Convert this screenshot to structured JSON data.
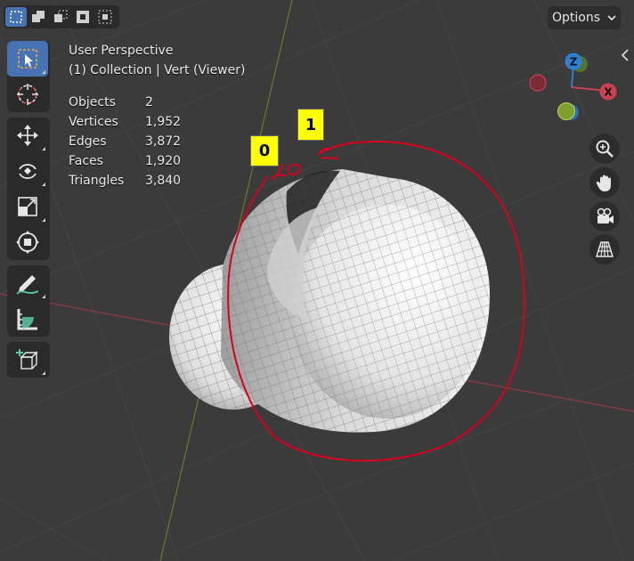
{
  "header": {
    "options_label": "Options",
    "select_modes": [
      "select-box",
      "select-extend",
      "select-subtract",
      "select-invert",
      "select-intersect"
    ]
  },
  "overlay": {
    "view_name": "User Perspective",
    "collection_line": "(1) Collection | Vert (Viewer)",
    "stats": [
      {
        "label": "Objects",
        "value": "2"
      },
      {
        "label": "Vertices",
        "value": "1,952"
      },
      {
        "label": "Edges",
        "value": "3,872"
      },
      {
        "label": "Faces",
        "value": "1,920"
      },
      {
        "label": "Triangles",
        "value": "3,840"
      }
    ]
  },
  "toolbar": {
    "tools": [
      "select-box",
      "cursor",
      "move",
      "rotate",
      "scale",
      "transform",
      "annotate",
      "measure",
      "add-cube"
    ],
    "active": "select-box"
  },
  "gizmo": {
    "z": "Z",
    "x": "X"
  },
  "annotations": {
    "tag_0": "0",
    "tag_1": "1"
  },
  "colors": {
    "background": "#3b3b3b",
    "accent": "#4772b3",
    "x_axis": "#c94250",
    "y_axis": "#7ea02f",
    "z_axis": "#2f7fd6",
    "annotation": "#e0001a",
    "tag": "#ffff00"
  }
}
